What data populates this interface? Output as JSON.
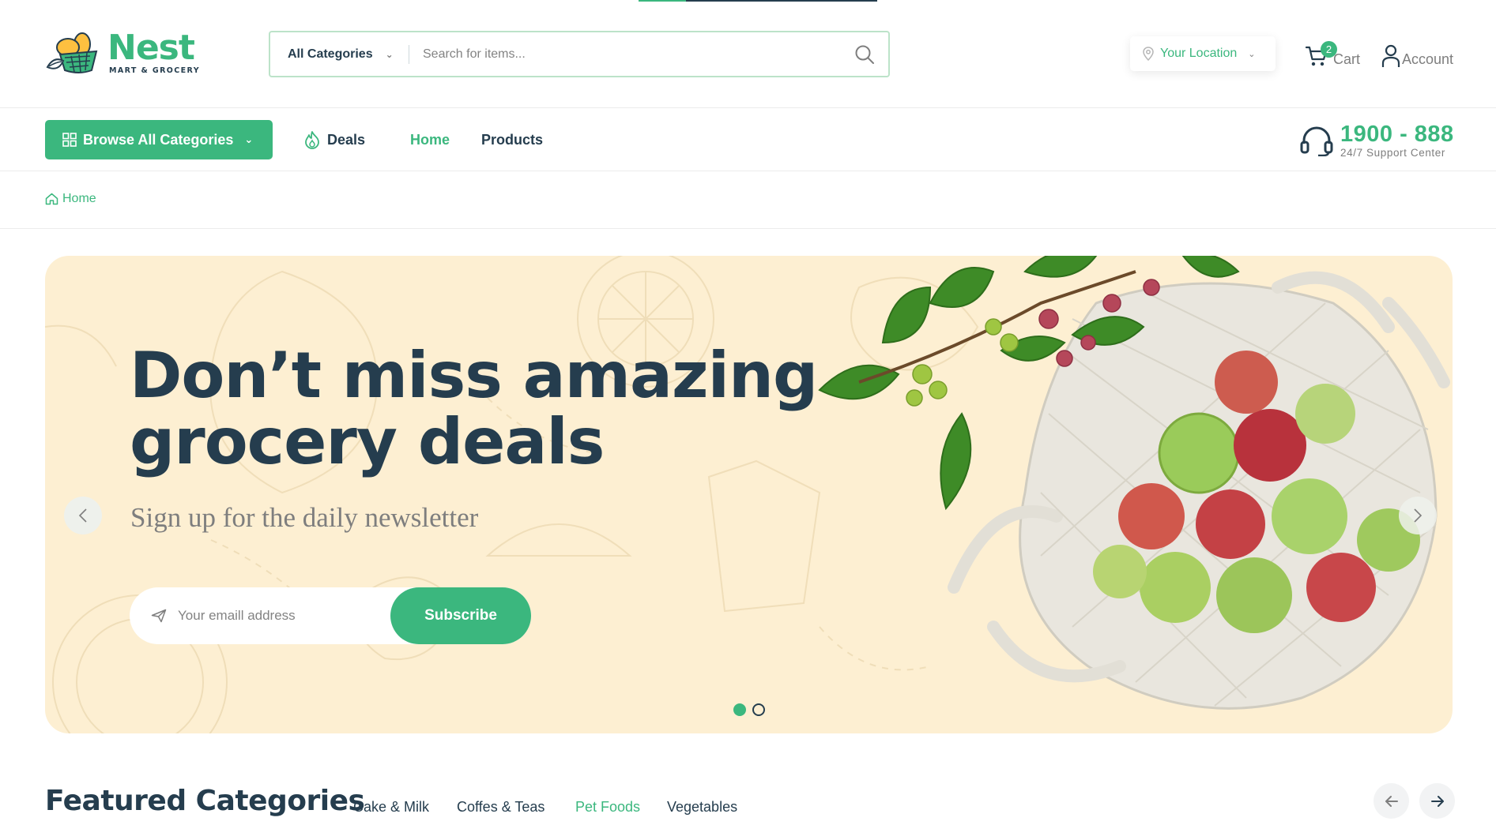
{
  "header": {
    "logo": {
      "name": "Nest",
      "tagline": "MART & GROCERY"
    },
    "search": {
      "category": "All Categories",
      "placeholder": "Search for items..."
    },
    "location_label": "Your Location",
    "cart": {
      "label": "Cart",
      "count": "2"
    },
    "account_label": "Account"
  },
  "nav": {
    "browse_label": "Browse All Categories",
    "items": [
      {
        "label": "Deals"
      },
      {
        "label": "Home"
      },
      {
        "label": "Products"
      }
    ],
    "active_item": "Home",
    "support": {
      "number": "1900 - 888",
      "label": "24/7 Support Center"
    }
  },
  "breadcrumb": {
    "home": "Home"
  },
  "hero": {
    "title_line1": "Don’t miss amazing",
    "title_line2": "grocery deals",
    "subtitle": "Sign up for the daily newsletter",
    "email_placeholder": "Your emaill address",
    "subscribe_label": "Subscribe",
    "slides": {
      "count": 2,
      "active": 1
    }
  },
  "featured": {
    "title": "Featured Categories",
    "tabs": [
      {
        "label": "Cake & Milk"
      },
      {
        "label": "Coffes & Teas"
      },
      {
        "label": "Pet Foods"
      },
      {
        "label": "Vegetables"
      }
    ],
    "active_tab": "Pet Foods"
  },
  "colors": {
    "brand": "#3BB77E",
    "heading": "#253D4E",
    "muted": "#7E7E7E",
    "hero_bg": "#FDEFD2",
    "search_border": "#BCE3C9"
  },
  "icons": {
    "search": "search-icon",
    "location": "map-pin-icon",
    "cart": "cart-icon",
    "account": "user-icon",
    "browse": "grid-icon",
    "deals": "flame-icon",
    "support": "headset-icon",
    "breadcrumb": "home-icon",
    "email": "send-icon"
  }
}
